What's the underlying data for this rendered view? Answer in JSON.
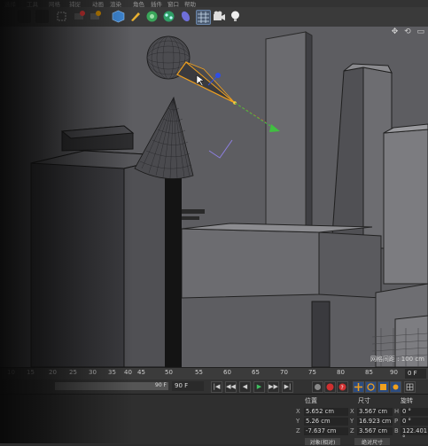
{
  "menu": {
    "items": [
      "文件",
      "编辑",
      "创建",
      "选择",
      "工具",
      "网格",
      "捕捉",
      "动画",
      "模拟",
      "渲染",
      "雕刻",
      "运动跟踪",
      "角色",
      "流水线",
      "插件",
      "脚本",
      "窗口",
      "帮助"
    ]
  },
  "toolbar": {
    "icons": [
      "undo-icon",
      "redo-icon",
      "select-icon",
      "move-icon",
      "scale-icon",
      "rotate-icon",
      "render-region-icon",
      "render-view-icon",
      "render-settings-icon",
      "cube-icon",
      "pen-icon",
      "subdivision-icon",
      "array-icon",
      "deformer-icon",
      "floor-icon",
      "camera-icon",
      "light-icon"
    ]
  },
  "viewport": {
    "grid_spacing_label": "网格间距 : 100 cm",
    "nav_icons": "✥ ⟲ ▭"
  },
  "timeline": {
    "ticks": [
      "0",
      "5",
      "10",
      "15",
      "20",
      "25",
      "30",
      "35",
      "40",
      "45",
      "50",
      "55",
      "60",
      "65",
      "70",
      "75",
      "80",
      "85",
      "90"
    ],
    "end_frame": "0 F"
  },
  "playback": {
    "range_value": "90 F",
    "current_frame": "90 F",
    "buttons": [
      "|◀",
      "◀◀",
      "◀",
      "▶",
      "▶▶",
      "▶|"
    ]
  },
  "attributes": {
    "headers": {
      "position": "位置",
      "size": "尺寸",
      "rotation": "旋转"
    },
    "rows": [
      {
        "axis": "X",
        "pos": "5.652 cm",
        "size_axis": "X",
        "size": "3.567 cm",
        "rot_axis": "H",
        "rot": "0 °"
      },
      {
        "axis": "Y",
        "pos": "5.26 cm",
        "size_axis": "Y",
        "size": "16.923 cm",
        "rot_axis": "P",
        "rot": "0 °"
      },
      {
        "axis": "Z",
        "pos": "-7.637 cm",
        "size_axis": "Z",
        "size": "3.567 cm",
        "rot_axis": "B",
        "rot": "122.401 °"
      }
    ],
    "mode_left": "对象(相对)",
    "mode_right": "绝对尺寸"
  },
  "colors": {
    "viewport_bg": "#5f5f63",
    "selection_orange": "#f0a01e",
    "axis_red": "#e04040",
    "axis_green": "#40c040",
    "axis_blue": "#3050e0"
  }
}
